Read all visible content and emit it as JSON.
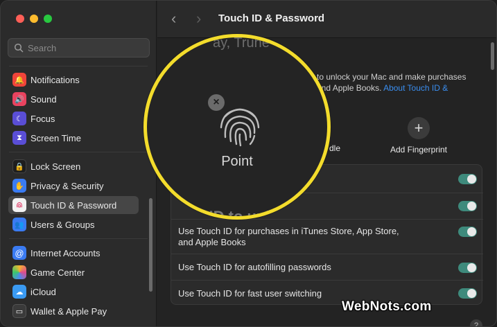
{
  "window": {
    "title": "Touch ID & Password"
  },
  "search": {
    "placeholder": "Search"
  },
  "sidebar": {
    "items": [
      {
        "label": "Notifications",
        "icon": "bell-icon",
        "color": "#f0443a"
      },
      {
        "label": "Sound",
        "icon": "speaker-icon",
        "color": "#e9435f"
      },
      {
        "label": "Focus",
        "icon": "moon-icon",
        "color": "#5a4ed6"
      },
      {
        "label": "Screen Time",
        "icon": "hourglass-icon",
        "color": "#5a4ed6"
      },
      {
        "label": "Lock Screen",
        "icon": "lock-icon",
        "color": "#1e1e1e"
      },
      {
        "label": "Privacy & Security",
        "icon": "hand-icon",
        "color": "#3a7bf2"
      },
      {
        "label": "Touch ID & Password",
        "icon": "fingerprint-icon",
        "color": "#f2f2f2"
      },
      {
        "label": "Users & Groups",
        "icon": "users-icon",
        "color": "#3a7bf2"
      },
      {
        "label": "Internet Accounts",
        "icon": "at-icon",
        "color": "#3a7bf2"
      },
      {
        "label": "Game Center",
        "icon": "game-center-icon",
        "color": "#ffffff"
      },
      {
        "label": "iCloud",
        "icon": "cloud-icon",
        "color": "#3a9af2"
      },
      {
        "label": "Wallet & Apple Pay",
        "icon": "wallet-icon",
        "color": "#3a3a3a"
      }
    ]
  },
  "intro": {
    "line1": "to unlock your Mac and make purchases",
    "line2": "and Apple Books.",
    "link": "About Touch ID &"
  },
  "fingerprints": {
    "partial_label": "dle",
    "add_label": "Add Fingerprint"
  },
  "settings": {
    "rows": [
      {
        "label": "",
        "on": true
      },
      {
        "label": "",
        "on": true
      },
      {
        "label": "Use Touch ID for purchases in iTunes Store, App Store,",
        "label2": "and Apple Books",
        "on": true
      },
      {
        "label": "Use Touch ID for autofilling passwords",
        "on": true
      },
      {
        "label": "Use Touch ID for fast user switching",
        "on": true
      }
    ]
  },
  "magnifier": {
    "faded_top": "ay, Trune",
    "label": "Point",
    "faded_bottom": "h ID to unl"
  },
  "watermark": "WebNots.com",
  "help": "?"
}
